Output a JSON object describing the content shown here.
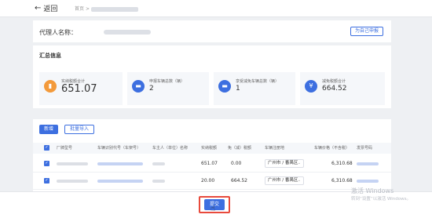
{
  "header": {
    "back_label": "返回",
    "breadcrumb_home": "首页",
    "breadcrumb_sep": ">"
  },
  "agent": {
    "label": "代理人名称：",
    "self_declare_button": "为自己申报"
  },
  "summary": {
    "title": "汇总信息",
    "stats": [
      {
        "label": "实纳税额合计",
        "value": "651.07",
        "icon": "chart-bar-icon",
        "color": "#f39a3b"
      },
      {
        "label": "申报车辆总数（辆）",
        "value": "2",
        "icon": "car-icon",
        "color": "#3d6fe0"
      },
      {
        "label": "享受减免车辆总数（辆）",
        "value": "1",
        "icon": "car-icon",
        "color": "#3d6fe0"
      },
      {
        "label": "减免税额合计",
        "value": "664.52",
        "icon": "yen-icon",
        "color": "#3d6fe0"
      }
    ]
  },
  "table": {
    "add_button": "新增",
    "import_button": "批量导入",
    "columns": [
      "厂牌型号",
      "车辆识别代号（车架号）",
      "车主人（单位）名称",
      "实纳税额",
      "免（减）税额",
      "车辆注册地",
      "车辆价格（不含税）",
      "发票号码"
    ],
    "rows": [
      {
        "tax": "651.07",
        "exempt": "0.00",
        "region": "广州市 / 番禺区",
        "price": "6,310.68"
      },
      {
        "tax": "20.00",
        "exempt": "664.52",
        "region": "广州市 / 番禺区",
        "price": "6,310.68"
      }
    ]
  },
  "footer": {
    "submit_button": "提交"
  },
  "watermark": {
    "line1": "激活 Windows",
    "line2": "转到“设置”以激活 Windows。"
  },
  "colors": {
    "primary": "#3d6fe0",
    "highlight": "#e84a3c",
    "orange": "#f39a3b"
  }
}
